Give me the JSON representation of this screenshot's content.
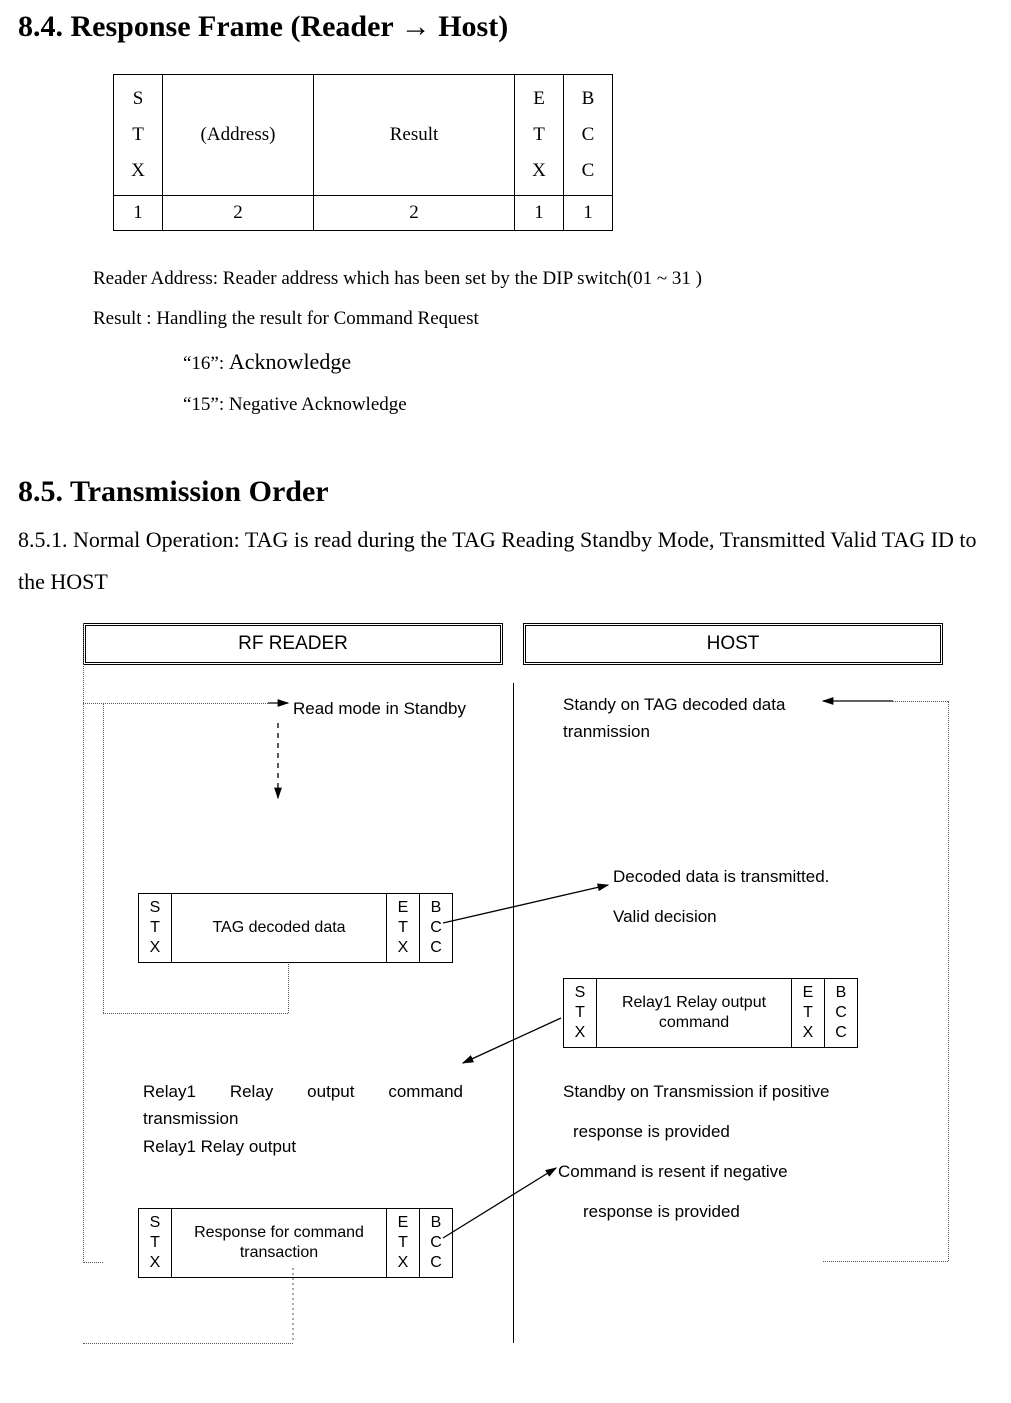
{
  "section84": {
    "title": "8.4. Response Frame (Reader → Host)",
    "frame": {
      "cells": {
        "stx": "S\nT\nX",
        "address": "(Address)",
        "result": "Result",
        "etx": "E\nT\nX",
        "bcc": "B\nC\nC"
      },
      "widths": {
        "stx": "1",
        "address": "2",
        "result": "2",
        "etx": "1",
        "bcc": "1"
      }
    },
    "desc_line1": "Reader Address: Reader address which has been set by the DIP switch(01 ~ 31 )",
    "desc_line2": "Result : Handling the result for Command Request",
    "desc_line3_prefix": "“16”: ",
    "desc_line3_word": "Acknowledge",
    "desc_line4": "“15”: Negative Acknowledge"
  },
  "section85": {
    "title": "8.5. Transmission Order",
    "sub": "8.5.1. Normal Operation: TAG is read during the TAG Reading Standby Mode, Transmitted Valid TAG ID to the HOST"
  },
  "diagram": {
    "reader_header": "RF READER",
    "host_header": "HOST",
    "read_mode": "Read mode in Standby",
    "host_standby": "Standy on TAG decoded data tranmission",
    "decoded_txt_1": "Decoded data is transmitted.",
    "decoded_txt_2": "Valid decision",
    "relay_left_1": "Relay1 Relay output command transmission",
    "relay_left_2": "Relay1   Relay output",
    "host_resp_1": "Standby on Transmission if positive",
    "host_resp_2": "response is provided",
    "host_resp_3": "Command is resent if negative",
    "host_resp_4": "response is provided",
    "mini_stx": "S\nT\nX",
    "mini_etx": "E\nT\nX",
    "mini_bcc": "B\nC\nC",
    "mini1_mid": "TAG decoded data",
    "mini2_mid": "Relay1 Relay output command",
    "mini3_mid": "Response for command transaction"
  }
}
